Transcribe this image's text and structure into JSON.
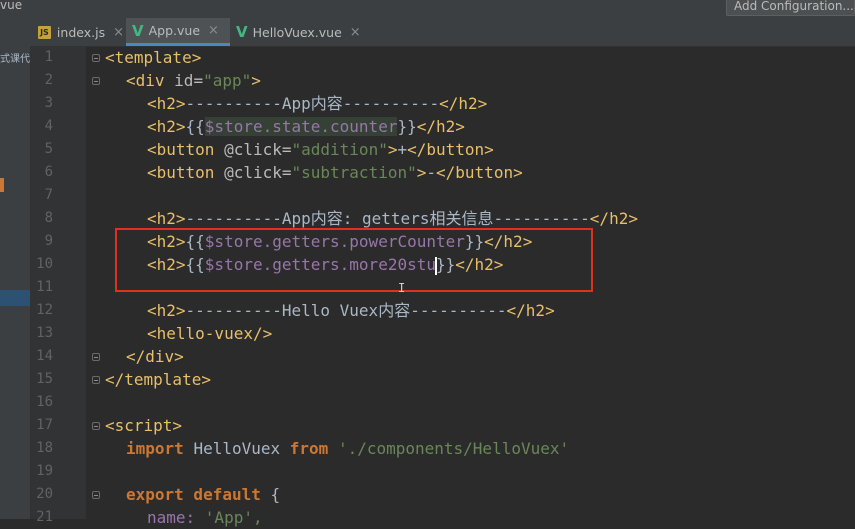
{
  "window": {
    "breadcrumb": "vue",
    "add_configuration": "Add Configuration..."
  },
  "tabs": [
    {
      "label": "index.js",
      "icon": "js-file-icon",
      "active": false
    },
    {
      "label": "App.vue",
      "icon": "vue-file-icon",
      "active": true
    },
    {
      "label": "HelloVuex.vue",
      "icon": "vue-file-icon",
      "active": false
    }
  ],
  "left_panel_fragment": "式课代",
  "colors": {
    "accent": "#4a88c7",
    "highlight_box": "#e0301e",
    "tag": "#e8bf6a",
    "string": "#6a8759",
    "keyword": "#cc7832"
  },
  "line_numbers": [
    "1",
    "2",
    "3",
    "4",
    "5",
    "6",
    "7",
    "8",
    "9",
    "10",
    "11",
    "12",
    "13",
    "14",
    "15",
    "16",
    "17",
    "18",
    "19",
    "20",
    "21"
  ],
  "code": {
    "l1": {
      "a": "<template>"
    },
    "l2": {
      "a": "<div ",
      "b": "id=",
      "c": "\"app\"",
      "d": ">"
    },
    "l3": {
      "a": "<h2>",
      "b": "----------App内容----------",
      "c": "</h2>"
    },
    "l4": {
      "a": "<h2>",
      "b": "{{",
      "c": "$store.state.counter",
      "d": "}}",
      "e": "</h2>"
    },
    "l5": {
      "a": "<button ",
      "b": "@click=",
      "c": "\"addition\"",
      "d": ">",
      "e": "+",
      "f": "</button>"
    },
    "l6": {
      "a": "<button ",
      "b": "@click=",
      "c": "\"subtraction\"",
      "d": ">",
      "e": "-",
      "f": "</button>"
    },
    "l8": {
      "a": "<h2>",
      "b": "----------App内容: getters相关信息----------",
      "c": "</h2>"
    },
    "l9": {
      "a": "<h2>",
      "b": "{{",
      "c": "$store.getters.powerCounter",
      "d": "}}",
      "e": "</h2>"
    },
    "l10": {
      "a": "<h2>",
      "b": "{{",
      "c": "$store.getters.more20stu",
      "d": "}}",
      "e": "</h2>"
    },
    "l12": {
      "a": "<h2>",
      "b": "----------Hello Vuex内容----------",
      "c": "</h2>"
    },
    "l13": {
      "a": "<hello-vuex/>"
    },
    "l14": {
      "a": "</div>"
    },
    "l15": {
      "a": "</template>"
    },
    "l17": {
      "a": "<script>"
    },
    "l18": {
      "a": "import ",
      "b": "HelloVuex ",
      "c": "from ",
      "d": "'./components/HelloVuex'"
    },
    "l20": {
      "a": "export default ",
      "b": "{"
    },
    "l21": {
      "a": "name: ",
      "b": "'App',"
    }
  }
}
